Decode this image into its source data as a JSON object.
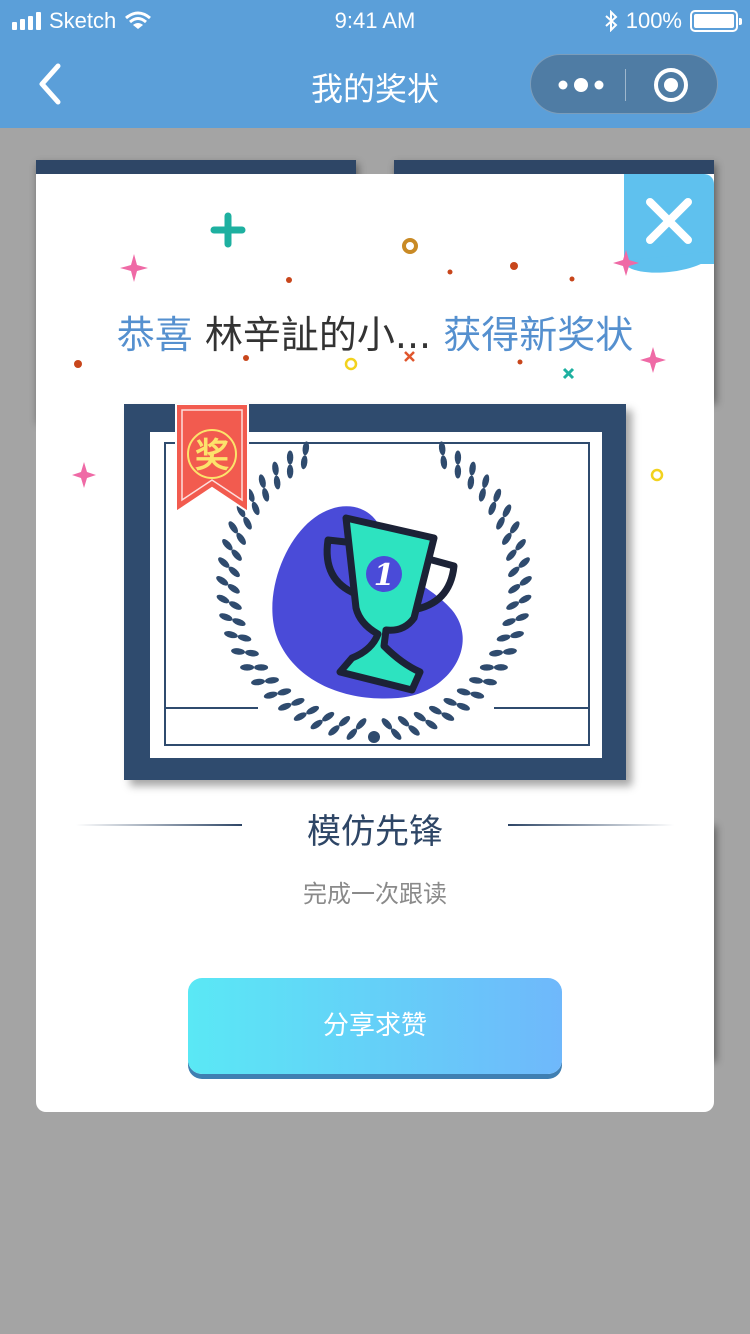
{
  "status_bar": {
    "carrier": "Sketch",
    "time": "9:41 AM",
    "battery": "100%"
  },
  "nav": {
    "title": "我的奖状"
  },
  "modal": {
    "congrats": "恭喜",
    "user_name": "林辛訨的小...",
    "obtained": "获得新奖状",
    "award_title": "模仿先锋",
    "award_desc": "完成一次跟读",
    "share_label": "分享求赞"
  },
  "certificate": {
    "ribbon_char": "奖",
    "rank": "1"
  },
  "colors": {
    "nav_blue": "#5b9fd9",
    "accent": "#5590cf",
    "frame": "#2f4b6e",
    "close_bg": "#5fc1ee",
    "blob": "#4a4bd8",
    "trophy": "#2de3c0"
  }
}
